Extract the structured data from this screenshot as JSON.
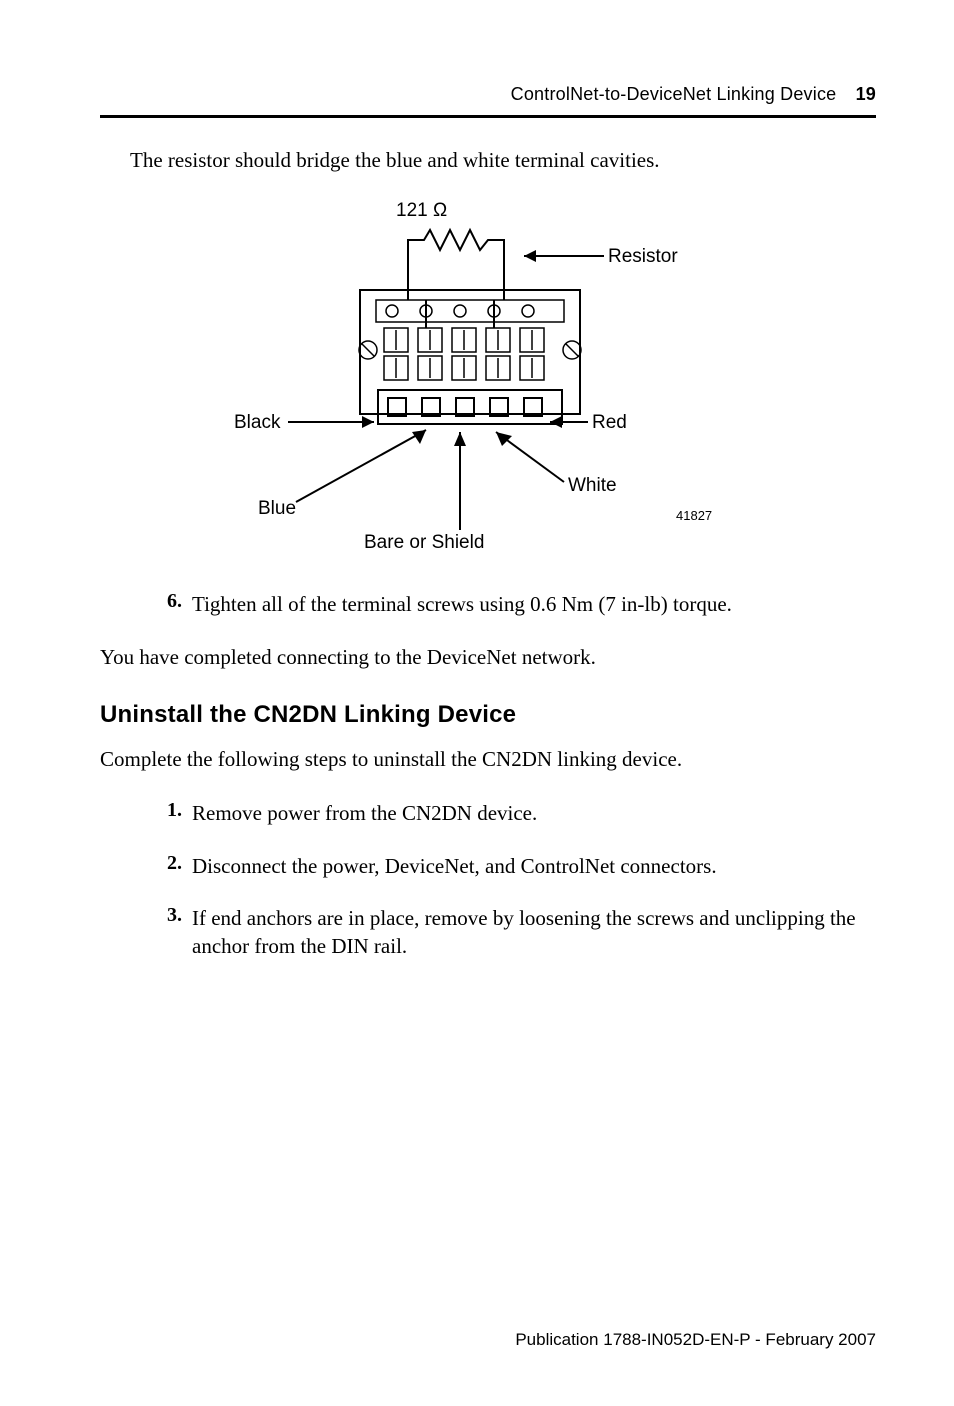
{
  "header": {
    "doc_title": "ControlNet-to-DeviceNet Linking Device",
    "page_number": "19"
  },
  "intro_paragraph": "The resistor should bridge the blue and white terminal cavities.",
  "figure": {
    "ohm_label": "121 Ω",
    "resistor": "Resistor",
    "black": "Black",
    "red": "Red",
    "white": "White",
    "blue": "Blue",
    "bare": "Bare or Shield",
    "ref": "41827"
  },
  "list1": {
    "num": "6.",
    "text": "Tighten all of the terminal screws using 0.6 Nm (7 in-lb) torque."
  },
  "after_list": "You have completed connecting to the DeviceNet network.",
  "section_heading": "Uninstall the CN2DN Linking Device",
  "section_intro": "Complete the following steps to uninstall the CN2DN linking device.",
  "steps": [
    {
      "num": "1.",
      "text": "Remove power from the CN2DN device."
    },
    {
      "num": "2.",
      "text": "Disconnect the power, DeviceNet, and ControlNet connectors."
    },
    {
      "num": "3.",
      "text": "If end anchors are in place, remove by loosening the screws and unclipping the anchor from the DIN rail."
    }
  ],
  "footer": {
    "prefix": "Publication",
    "code": "1788-IN052D-EN-P - February 2007"
  }
}
